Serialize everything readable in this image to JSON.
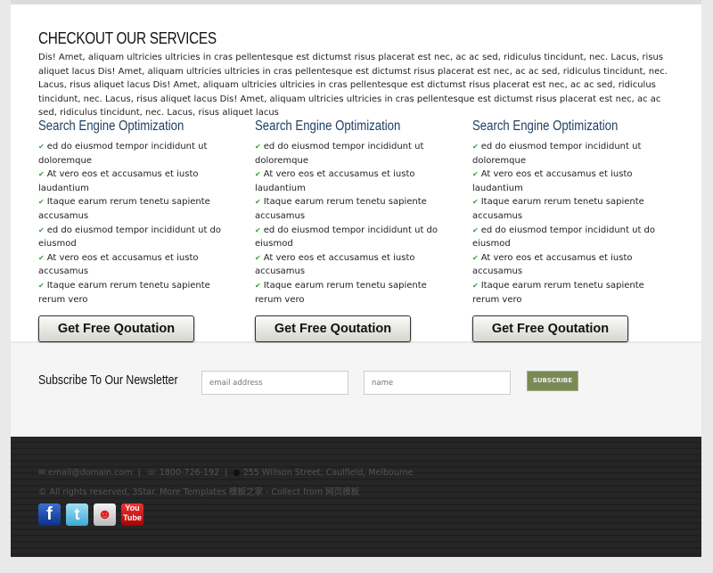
{
  "services": {
    "title": "CHECKOUT OUR SERVICES",
    "intro": "Dis! Amet, aliquam ultricies ultricies in cras pellentesque est dictumst risus placerat est nec, ac ac sed, ridiculus tincidunt, nec. Lacus, risus aliquet lacus Dis! Amet, aliquam ultricies ultricies in cras pellentesque est dictumst risus placerat est nec, ac ac sed, ridiculus tincidunt, nec. Lacus, risus aliquet lacus Dis! Amet, aliquam ultricies ultricies in cras pellentesque est dictumst risus placerat est nec, ac ac sed, ridiculus tincidunt, nec. Lacus, risus aliquet lacus Dis! Amet, aliquam ultricies ultricies in cras pellentesque est dictumst risus placerat est nec, ac ac sed, ridiculus tincidunt, nec. Lacus, risus aliquet lacus",
    "columns": [
      {
        "title": "Search Engine Optimization",
        "items": [
          "ed do eiusmod tempor incididunt ut doloremque",
          "At vero eos et accusamus et iusto laudantium",
          "Itaque earum rerum tenetu sapiente accusamus",
          "ed do eiusmod tempor incididunt ut do eiusmod",
          "At vero eos et accusamus et iusto accusamus",
          "Itaque earum rerum tenetu sapiente rerum vero"
        ],
        "button": "Get Free Qoutation"
      },
      {
        "title": "Search Engine Optimization",
        "items": [
          "ed do eiusmod tempor incididunt ut doloremque",
          "At vero eos et accusamus et iusto laudantium",
          "Itaque earum rerum tenetu sapiente accusamus",
          "ed do eiusmod tempor incididunt ut do eiusmod",
          "At vero eos et accusamus et iusto accusamus",
          "Itaque earum rerum tenetu sapiente rerum vero"
        ],
        "button": "Get Free Qoutation"
      },
      {
        "title": "Search Engine Optimization",
        "items": [
          "ed do eiusmod tempor incididunt ut doloremque",
          "At vero eos et accusamus et iusto laudantium",
          "Itaque earum rerum tenetu sapiente accusamus",
          "ed do eiusmod tempor incididunt ut do eiusmod",
          "At vero eos et accusamus et iusto accusamus",
          "Itaque earum rerum tenetu sapiente rerum vero"
        ],
        "button": "Get Free Qoutation"
      }
    ]
  },
  "newsletter": {
    "label": "Subscribe To Our Newsletter",
    "email_placeholder": "email address",
    "name_placeholder": "name",
    "button": "SUBSCRIBE"
  },
  "footer": {
    "email": "email@domain.com",
    "phone": "1800-726-192",
    "address": "255  Willson Street, Caulfield, Melbourne",
    "copyright": "© All rights reserved, 3Star. More Templates 模板之家 - Collect from 网页模板",
    "social": [
      {
        "icon": "facebook-icon",
        "label": "f"
      },
      {
        "icon": "twitter-icon",
        "label": "t"
      },
      {
        "icon": "reddit-icon",
        "label": "☻"
      },
      {
        "icon": "youtube-icon",
        "label": "You Tube"
      }
    ]
  },
  "colors": {
    "heading": "#1d3e5e",
    "check": "#3a9a3a",
    "subscribe": "#7a8a55",
    "footer": "#242424"
  }
}
